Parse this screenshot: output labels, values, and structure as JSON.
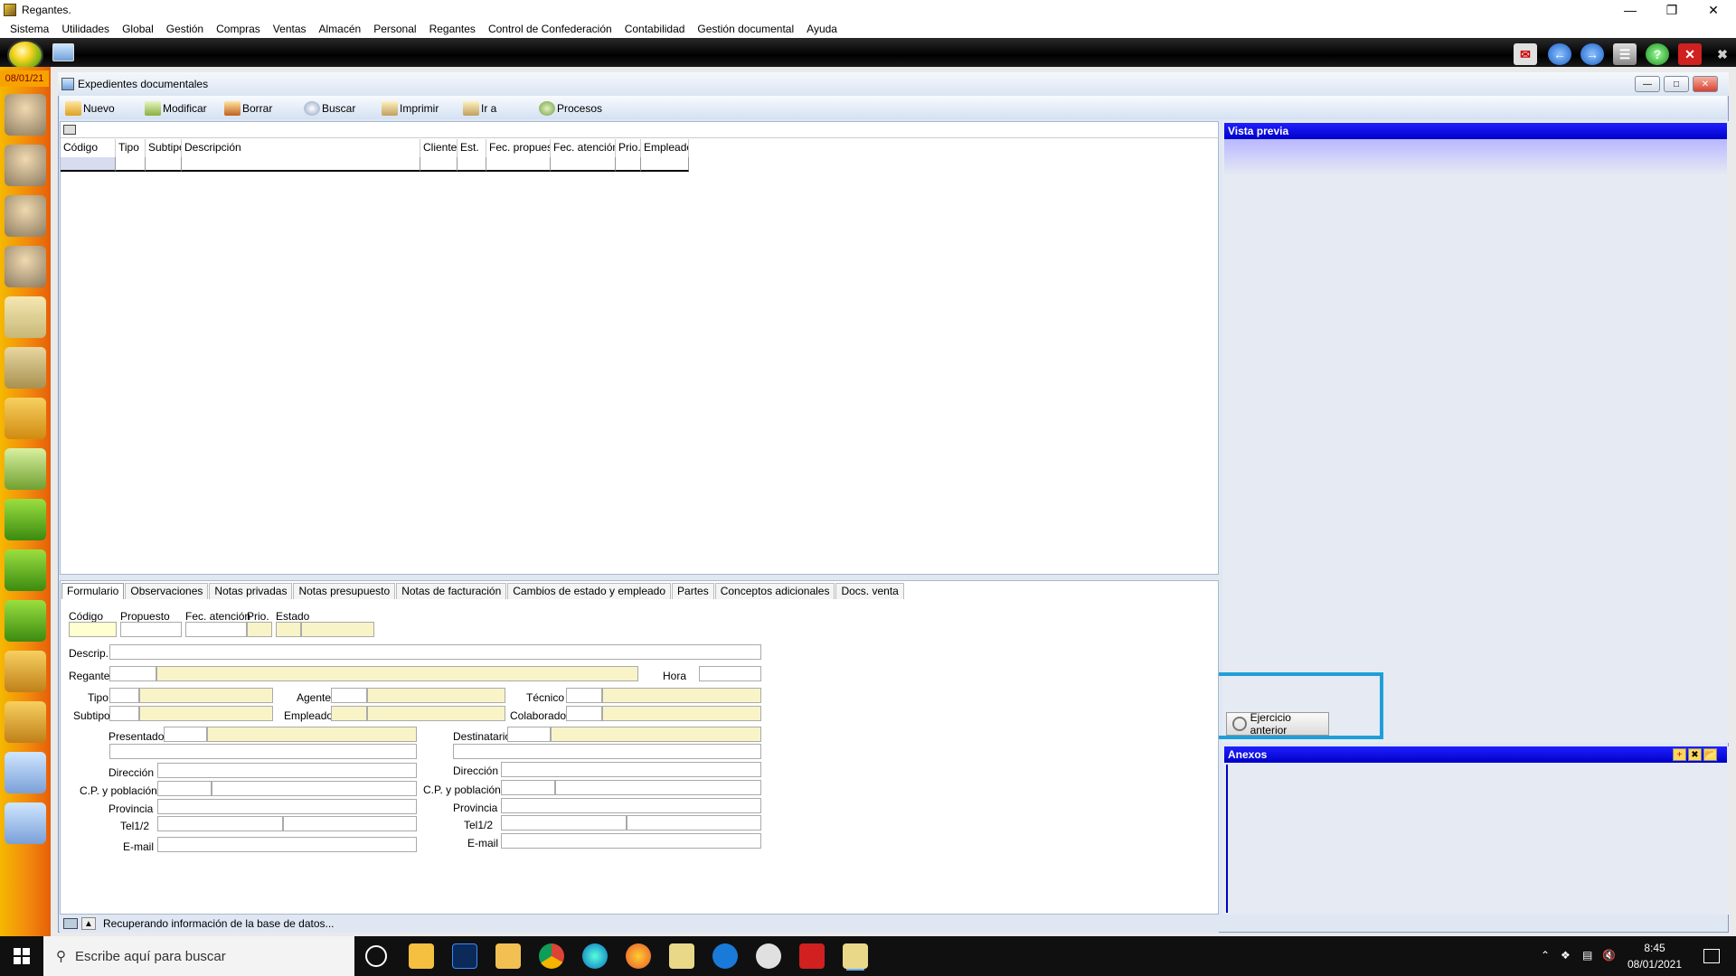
{
  "app": {
    "title": "Regantes."
  },
  "menu": [
    "Sistema",
    "Utilidades",
    "Global",
    "Gestión",
    "Compras",
    "Ventas",
    "Almacén",
    "Personal",
    "Regantes",
    "Control de Confederación",
    "Contabilidad",
    "Gestión documental",
    "Ayuda"
  ],
  "sidebar": {
    "date": "08/01/21"
  },
  "window": {
    "title": "Expedientes documentales"
  },
  "toolbar": {
    "nuevo": "Nuevo",
    "modificar": "Modificar",
    "borrar": "Borrar",
    "buscar": "Buscar",
    "imprimir": "Imprimir",
    "ir_a": "Ir a",
    "procesos": "Procesos"
  },
  "grid": {
    "columns": [
      "Código",
      "Tipo",
      "Subtipo",
      "Descripción",
      "Cliente",
      "Est.",
      "Fec. propues.",
      "Fec. atención",
      "Prio.",
      "Empleado"
    ]
  },
  "preview": {
    "title": "Vista previa",
    "ejercicio_button": "Ejercicio anterior"
  },
  "anexos": {
    "title": "Anexos"
  },
  "tabs": [
    "Formulario",
    "Observaciones",
    "Notas privadas",
    "Notas presupuesto",
    "Notas de facturación",
    "Cambios de estado y empleado",
    "Partes",
    "Conceptos adicionales",
    "Docs. venta"
  ],
  "form": {
    "codigo": "Código",
    "propuesto": "Propuesto",
    "fec_atencion": "Fec. atención",
    "prio": "Prio.",
    "estado": "Estado",
    "descrip": "Descrip.",
    "regante": "Regante",
    "hora": "Hora",
    "tipo": "Tipo",
    "subtipo": "Subtipo",
    "agente": "Agente",
    "empleado": "Empleado",
    "tecnico": "Técnico",
    "colaborador": "Colaborador",
    "presentador": "Presentador",
    "destinatario": "Destinatario",
    "direccion": "Dirección",
    "cp_poblacion": "C.P. y población",
    "provincia": "Provincia",
    "tel": "Tel1/2",
    "email": "E-mail"
  },
  "status": {
    "text": "Recuperando información de la base de datos..."
  },
  "taskbar": {
    "search_placeholder": "Escribe aquí para buscar",
    "time": "8:45",
    "date": "08/01/2021"
  }
}
